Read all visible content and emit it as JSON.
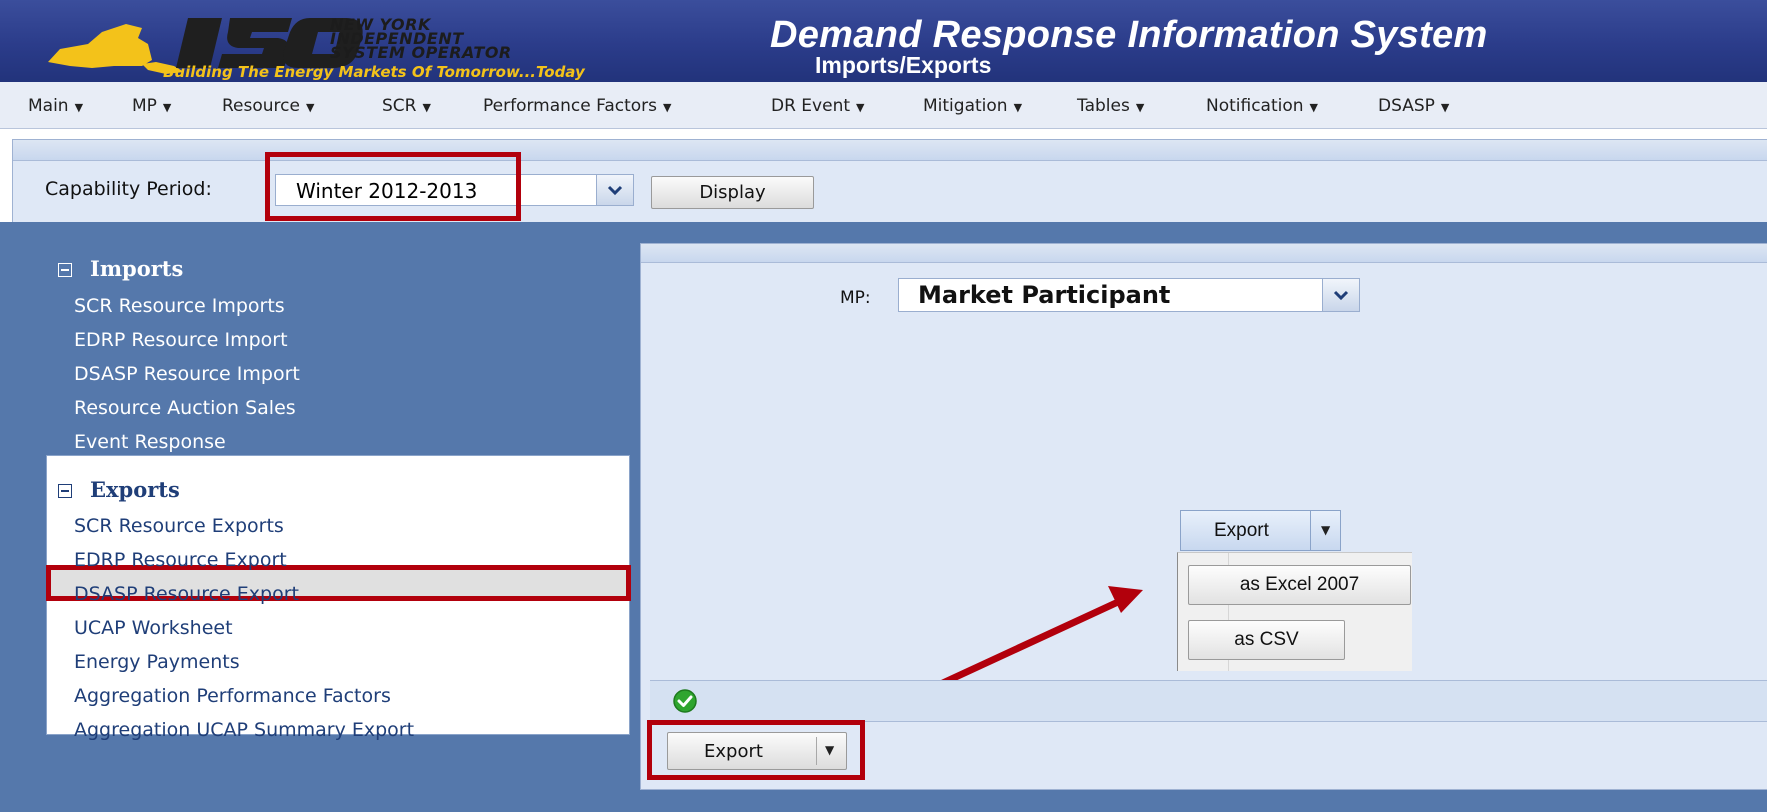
{
  "header": {
    "org_name_lines": [
      "NEW YORK",
      "INDEPENDENT",
      "SYSTEM OPERATOR"
    ],
    "logo_text": "ISO",
    "tagline": "Building The Energy Markets Of Tomorrow...Today",
    "app_title": "Demand Response Information System",
    "page_subtitle": "Imports/Exports"
  },
  "menu": [
    {
      "label": "Main"
    },
    {
      "label": "MP"
    },
    {
      "label": "Resource"
    },
    {
      "label": "SCR"
    },
    {
      "label": "Performance Factors"
    },
    {
      "label": "DR Event"
    },
    {
      "label": "Mitigation"
    },
    {
      "label": "Tables"
    },
    {
      "label": "Notification"
    },
    {
      "label": "DSASP"
    }
  ],
  "filters": {
    "capability_period_label": "Capability Period:",
    "capability_period_value": "Winter 2012-2013",
    "display_button": "Display"
  },
  "nav": {
    "imports": {
      "header": "Imports",
      "items": [
        "SCR Resource Imports",
        "EDRP Resource Import",
        "DSASP Resource Import",
        "Resource Auction Sales",
        "Event Response"
      ]
    },
    "exports": {
      "header": "Exports",
      "items": [
        "SCR Resource Exports",
        "EDRP Resource Export",
        "DSASP Resource Export",
        "UCAP Worksheet",
        "Energy Payments",
        "Aggregation Performance Factors",
        "Aggregation UCAP Summary Export"
      ],
      "selected": "DSASP Resource Export"
    }
  },
  "main": {
    "mp_label": "MP:",
    "mp_value": "Market Participant",
    "export_menu": {
      "button_label": "Export",
      "options": [
        "as Excel 2007",
        "as CSV"
      ]
    },
    "status_icon": "check-circle-icon",
    "toolbar_export_label": "Export"
  },
  "colors": {
    "header_bg": "#2b3c8a",
    "tagline": "#f3c21a",
    "body_bg": "#5578ab",
    "highlight": "#b2000c",
    "status_ok": "#2fa52f"
  }
}
